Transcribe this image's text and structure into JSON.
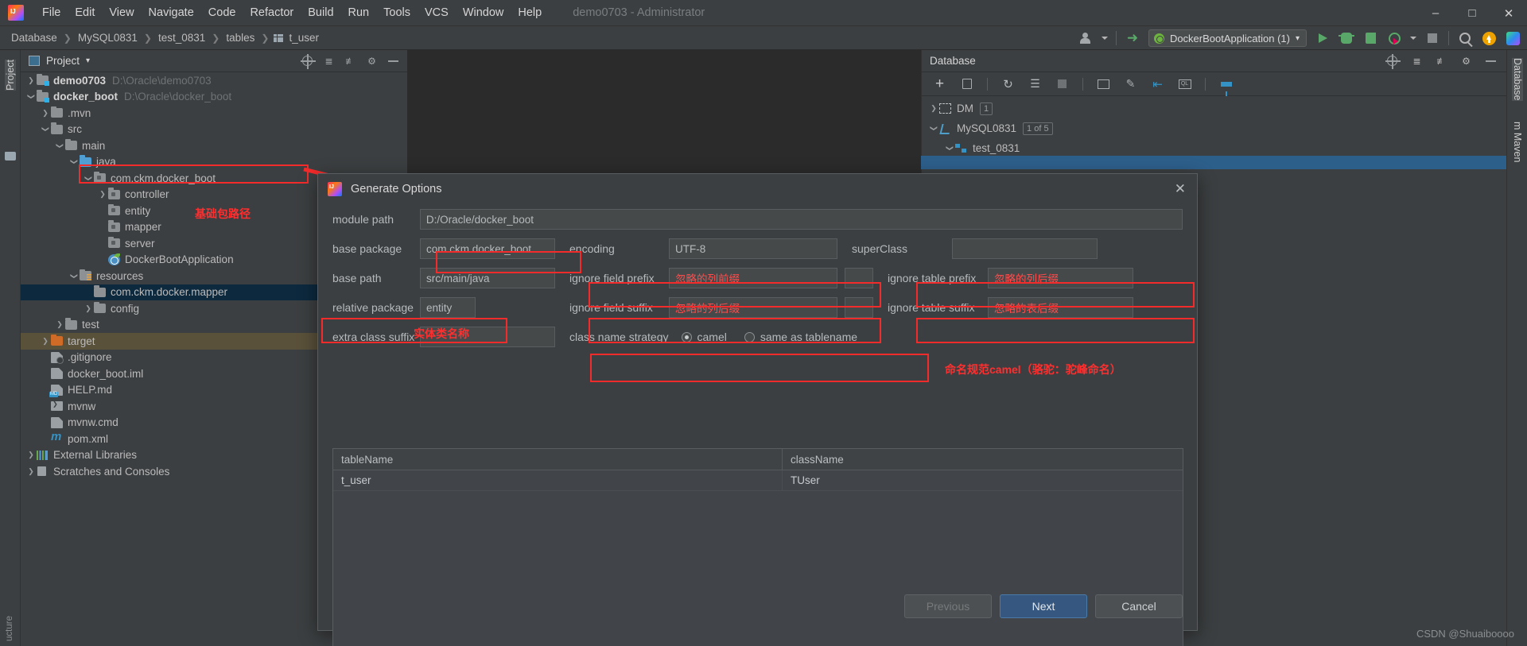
{
  "window": {
    "title": "demo0703 - Administrator",
    "minimize": "–",
    "maximize": "□",
    "close": "✕"
  },
  "menubar": {
    "logo_name": "intellij-idea-logo",
    "items": [
      "File",
      "Edit",
      "View",
      "Navigate",
      "Code",
      "Refactor",
      "Build",
      "Run",
      "Tools",
      "VCS",
      "Window",
      "Help"
    ]
  },
  "breadcrumb": {
    "items": [
      "Database",
      "MySQL0831",
      "test_0831",
      "tables",
      "t_user"
    ],
    "separator": "❯"
  },
  "toolbar": {
    "run_config": "DockerBootApplication (1)",
    "run_config_caret": "▾",
    "icons": [
      "avatar-icon",
      "vcs-update-icon",
      "run-icon",
      "debug-icon",
      "run-with-coverage-icon",
      "profile-icon",
      "stop-icon",
      "search-everywhere-icon",
      "update-icon",
      "plugin-icon"
    ]
  },
  "left_strip": {
    "project_label": "Project",
    "bottom_label": "ucture"
  },
  "right_strip": {
    "database_label": "Database",
    "maven_label": "m  Maven"
  },
  "project_panel": {
    "title": "Project",
    "title_caret": "▾",
    "tools": [
      "locate-icon",
      "expand-all-icon",
      "collapse-all-icon",
      "settings-gear-icon",
      "hide-icon"
    ],
    "tree": [
      {
        "indent": 0,
        "arrow": "right",
        "icon": "module",
        "label": "demo0703",
        "bold": true,
        "path": "D:\\Oracle\\demo0703",
        "state": ""
      },
      {
        "indent": 0,
        "arrow": "down",
        "icon": "module",
        "label": "docker_boot",
        "bold": true,
        "path": "D:\\Oracle\\docker_boot",
        "state": ""
      },
      {
        "indent": 1,
        "arrow": "right",
        "icon": "folder",
        "label": ".mvn",
        "bold": false,
        "path": "",
        "state": ""
      },
      {
        "indent": 1,
        "arrow": "down",
        "icon": "folder",
        "label": "src",
        "bold": false,
        "path": "",
        "state": ""
      },
      {
        "indent": 2,
        "arrow": "down",
        "icon": "folder",
        "label": "main",
        "bold": false,
        "path": "",
        "state": ""
      },
      {
        "indent": 3,
        "arrow": "down",
        "icon": "src",
        "label": "java",
        "bold": false,
        "path": "",
        "state": ""
      },
      {
        "indent": 4,
        "arrow": "down",
        "icon": "pkg",
        "label": "com.ckm.docker_boot",
        "bold": false,
        "path": "",
        "state": ""
      },
      {
        "indent": 5,
        "arrow": "right",
        "icon": "pkg",
        "label": "controller",
        "bold": false,
        "path": "",
        "state": ""
      },
      {
        "indent": 5,
        "arrow": "none",
        "icon": "pkg",
        "label": "entity",
        "bold": false,
        "path": "",
        "state": ""
      },
      {
        "indent": 5,
        "arrow": "none",
        "icon": "pkg",
        "label": "mapper",
        "bold": false,
        "path": "",
        "state": ""
      },
      {
        "indent": 5,
        "arrow": "none",
        "icon": "pkg",
        "label": "server",
        "bold": false,
        "path": "",
        "state": ""
      },
      {
        "indent": 5,
        "arrow": "none",
        "icon": "spring",
        "label": "DockerBootApplication",
        "bold": false,
        "path": "",
        "state": ""
      },
      {
        "indent": 3,
        "arrow": "down",
        "icon": "res",
        "label": "resources",
        "bold": false,
        "path": "",
        "state": ""
      },
      {
        "indent": 4,
        "arrow": "none",
        "icon": "folder",
        "label": "com.ckm.docker.mapper",
        "bold": false,
        "path": "",
        "state": "selected"
      },
      {
        "indent": 4,
        "arrow": "right",
        "icon": "folder",
        "label": "config",
        "bold": false,
        "path": "",
        "state": ""
      },
      {
        "indent": 2,
        "arrow": "right",
        "icon": "folder",
        "label": "test",
        "bold": false,
        "path": "",
        "state": ""
      },
      {
        "indent": 1,
        "arrow": "right",
        "icon": "target",
        "label": "target",
        "bold": false,
        "path": "",
        "state": "target"
      },
      {
        "indent": 1,
        "arrow": "none",
        "icon": "git",
        "label": ".gitignore",
        "bold": false,
        "path": "",
        "state": ""
      },
      {
        "indent": 1,
        "arrow": "none",
        "icon": "file",
        "label": "docker_boot.iml",
        "bold": false,
        "path": "",
        "state": ""
      },
      {
        "indent": 1,
        "arrow": "none",
        "icon": "md",
        "label": "HELP.md",
        "bold": false,
        "path": "",
        "state": ""
      },
      {
        "indent": 1,
        "arrow": "none",
        "icon": "sh",
        "label": "mvnw",
        "bold": false,
        "path": "",
        "state": ""
      },
      {
        "indent": 1,
        "arrow": "none",
        "icon": "file",
        "label": "mvnw.cmd",
        "bold": false,
        "path": "",
        "state": ""
      },
      {
        "indent": 1,
        "arrow": "none",
        "icon": "maven",
        "label": "pom.xml",
        "bold": false,
        "path": "",
        "state": ""
      },
      {
        "indent": 0,
        "arrow": "right",
        "icon": "lib",
        "label": "External Libraries",
        "bold": false,
        "path": "",
        "state": ""
      },
      {
        "indent": 0,
        "arrow": "right",
        "icon": "scratch",
        "label": "Scratches and Consoles",
        "bold": false,
        "path": "",
        "state": ""
      }
    ]
  },
  "database_panel": {
    "title": "Database",
    "head_tools": [
      "locate-icon",
      "expand-all-icon",
      "collapse-all-icon",
      "settings-gear-icon",
      "hide-icon"
    ],
    "toolbar_icons": [
      "add-icon",
      "duplicate-icon",
      "refresh-icon",
      "sync-icon",
      "stop-icon",
      "table-icon",
      "edit-icon",
      "jump-to-icon",
      "query-console-icon",
      "filter-icon"
    ],
    "tree": [
      {
        "arrow": "right",
        "icon": "dm-datasource-icon",
        "label": "DM",
        "badge": "1",
        "indent": 0
      },
      {
        "arrow": "down",
        "icon": "mysql-datasource-icon",
        "label": "MySQL0831",
        "badge": "1 of 5",
        "indent": 0
      },
      {
        "arrow": "down",
        "icon": "schema-icon",
        "label": "test_0831",
        "badge": "",
        "indent": 1
      }
    ]
  },
  "dialog": {
    "title": "Generate Options",
    "close_label": "✕",
    "fields": {
      "module_path_label": "module path",
      "module_path_value": "D:/Oracle/docker_boot",
      "base_package_label": "base package",
      "base_package_value": "com.ckm.docker_boot",
      "encoding_label": "encoding",
      "encoding_value": "UTF-8",
      "super_class_label": "superClass",
      "super_class_value": "",
      "base_path_label": "base path",
      "base_path_value": "src/main/java",
      "ignore_field_prefix_label": "ignore field prefix",
      "ignore_field_prefix_placeholder": "忽略的列前缀",
      "ignore_table_prefix_label": "ignore table prefix",
      "ignore_table_prefix_placeholder": "忽略的列后缀",
      "relative_package_label": "relative package",
      "relative_package_value": "entity",
      "ignore_field_suffix_label": "ignore field suffix",
      "ignore_field_suffix_placeholder": "忽略的列后缀",
      "ignore_table_suffix_label": "ignore table suffix",
      "ignore_table_suffix_placeholder": "忽略的表后缀",
      "extra_class_suffix_label": "extra class suffix",
      "extra_class_suffix_value": "",
      "class_name_strategy_label": "class name strategy",
      "class_name_strategy_option1": "camel",
      "class_name_strategy_option2": "same as tablename",
      "class_name_strategy_selected": "camel"
    },
    "table": {
      "columns": [
        "tableName",
        "className"
      ],
      "rows": [
        [
          "t_user",
          "TUser"
        ]
      ]
    },
    "buttons": {
      "previous": "Previous",
      "next": "Next",
      "cancel": "Cancel"
    }
  },
  "annotations": {
    "base_package_path": "基础包路径",
    "entity_class_name": "实体类名称",
    "naming_rule": "命名规范camel（骆驼：驼峰命名）"
  },
  "watermark": "CSDN @Shuaiboooo",
  "colors": {
    "accent_blue": "#365880",
    "annotation_red": "#f32b2b",
    "selection_blue": "#0d293e",
    "background": "#3c3f41"
  }
}
